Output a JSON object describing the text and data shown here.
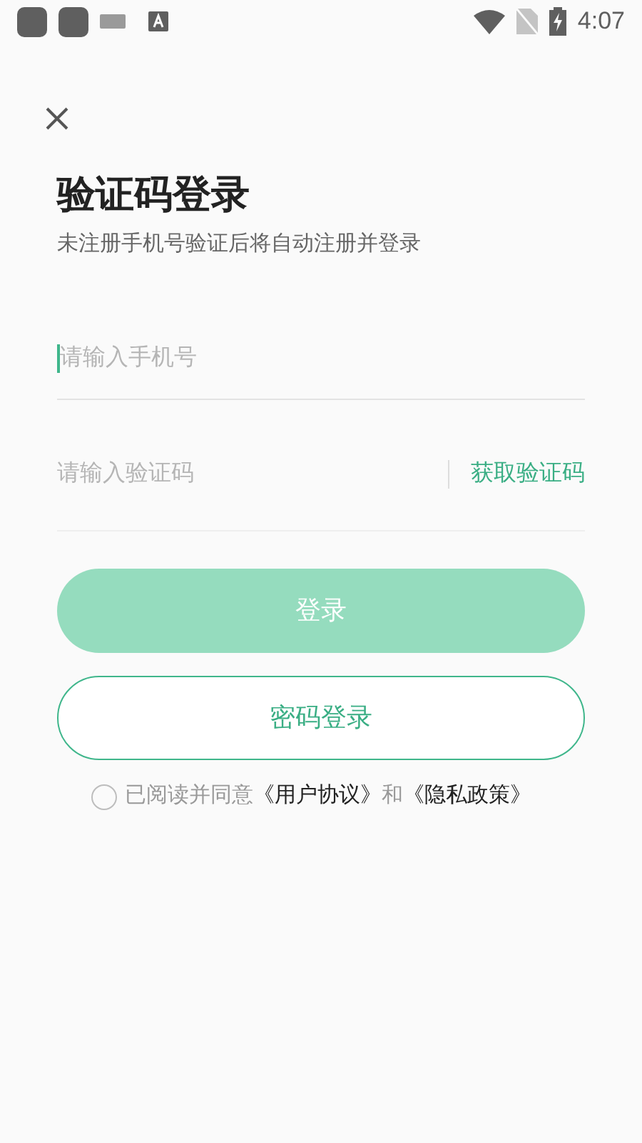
{
  "status_bar": {
    "time": "4:07"
  },
  "title": "验证码登录",
  "subtitle": "未注册手机号验证后将自动注册并登录",
  "phone_field": {
    "placeholder": "请输入手机号",
    "focused": true
  },
  "code_field": {
    "placeholder": "请输入验证码"
  },
  "get_code_link": "获取验证码",
  "login_button": {
    "label": "登录",
    "disabled": true
  },
  "password_login_button": "密码登录",
  "agreement": {
    "checked": false,
    "parts": [
      {
        "kind": "text",
        "text": "已阅读并同意"
      },
      {
        "kind": "link",
        "text": "《用户协议》"
      },
      {
        "kind": "text",
        "text": "和"
      },
      {
        "kind": "link",
        "text": "《隐私政策》"
      }
    ]
  }
}
